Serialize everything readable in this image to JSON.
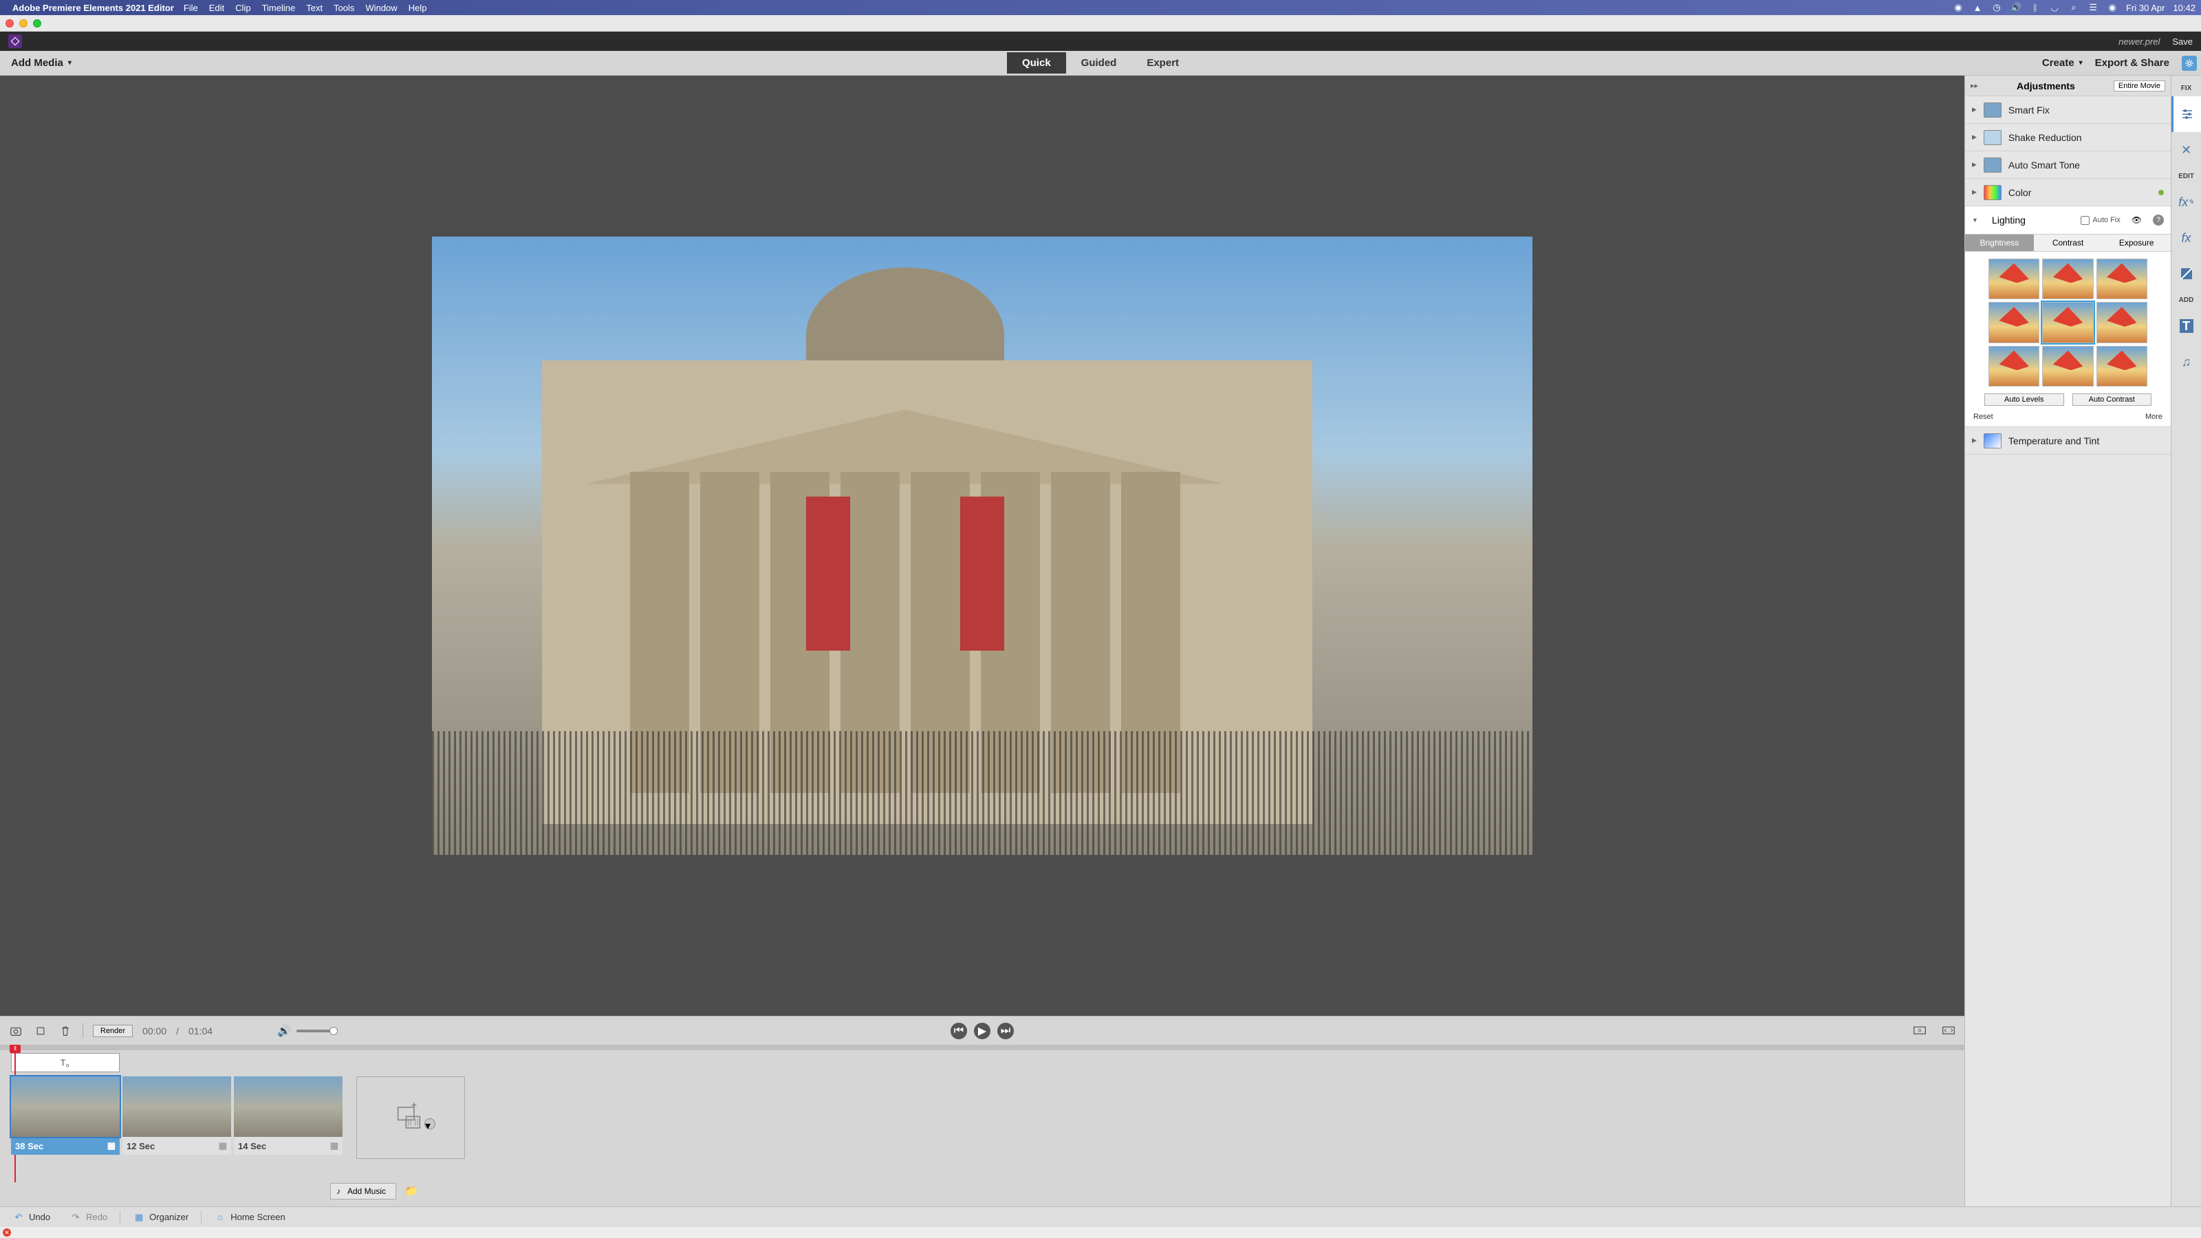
{
  "mac_menu": {
    "app": "Adobe Premiere Elements 2021 Editor",
    "items": [
      "File",
      "Edit",
      "Clip",
      "Timeline",
      "Text",
      "Tools",
      "Window",
      "Help"
    ],
    "date": "Fri 30 Apr",
    "time": "10:42"
  },
  "titlebar": {
    "filename": "newer.prel",
    "save": "Save"
  },
  "toolbar": {
    "add_media": "Add Media",
    "tabs": {
      "quick": "Quick",
      "guided": "Guided",
      "expert": "Expert",
      "active": "quick"
    },
    "create": "Create",
    "export": "Export & Share"
  },
  "playback": {
    "render": "Render",
    "time_current": "00:00",
    "time_sep": "/",
    "time_total": "01:04"
  },
  "timeline": {
    "clips": [
      {
        "duration": "38 Sec",
        "selected": true
      },
      {
        "duration": "12 Sec",
        "selected": false
      },
      {
        "duration": "14 Sec",
        "selected": false
      }
    ],
    "add_music": "Add Music"
  },
  "adjustments": {
    "header": "Adjustments",
    "entire_movie": "Entire Movie",
    "items": [
      {
        "label": "Smart Fix"
      },
      {
        "label": "Shake Reduction"
      },
      {
        "label": "Auto Smart Tone"
      },
      {
        "label": "Color",
        "indicator": true
      }
    ],
    "lighting": {
      "label": "Lighting",
      "auto_fix": "Auto Fix",
      "subtabs": {
        "brightness": "Brightness",
        "contrast": "Contrast",
        "exposure": "Exposure",
        "active": "brightness"
      },
      "auto_levels": "Auto Levels",
      "auto_contrast": "Auto Contrast",
      "reset": "Reset",
      "more": "More"
    },
    "temp_tint": "Temperature and Tint"
  },
  "toolstrip": {
    "fix": "FIX",
    "edit": "EDIT",
    "add": "ADD"
  },
  "bottombar": {
    "undo": "Undo",
    "redo": "Redo",
    "organizer": "Organizer",
    "home": "Home Screen"
  }
}
